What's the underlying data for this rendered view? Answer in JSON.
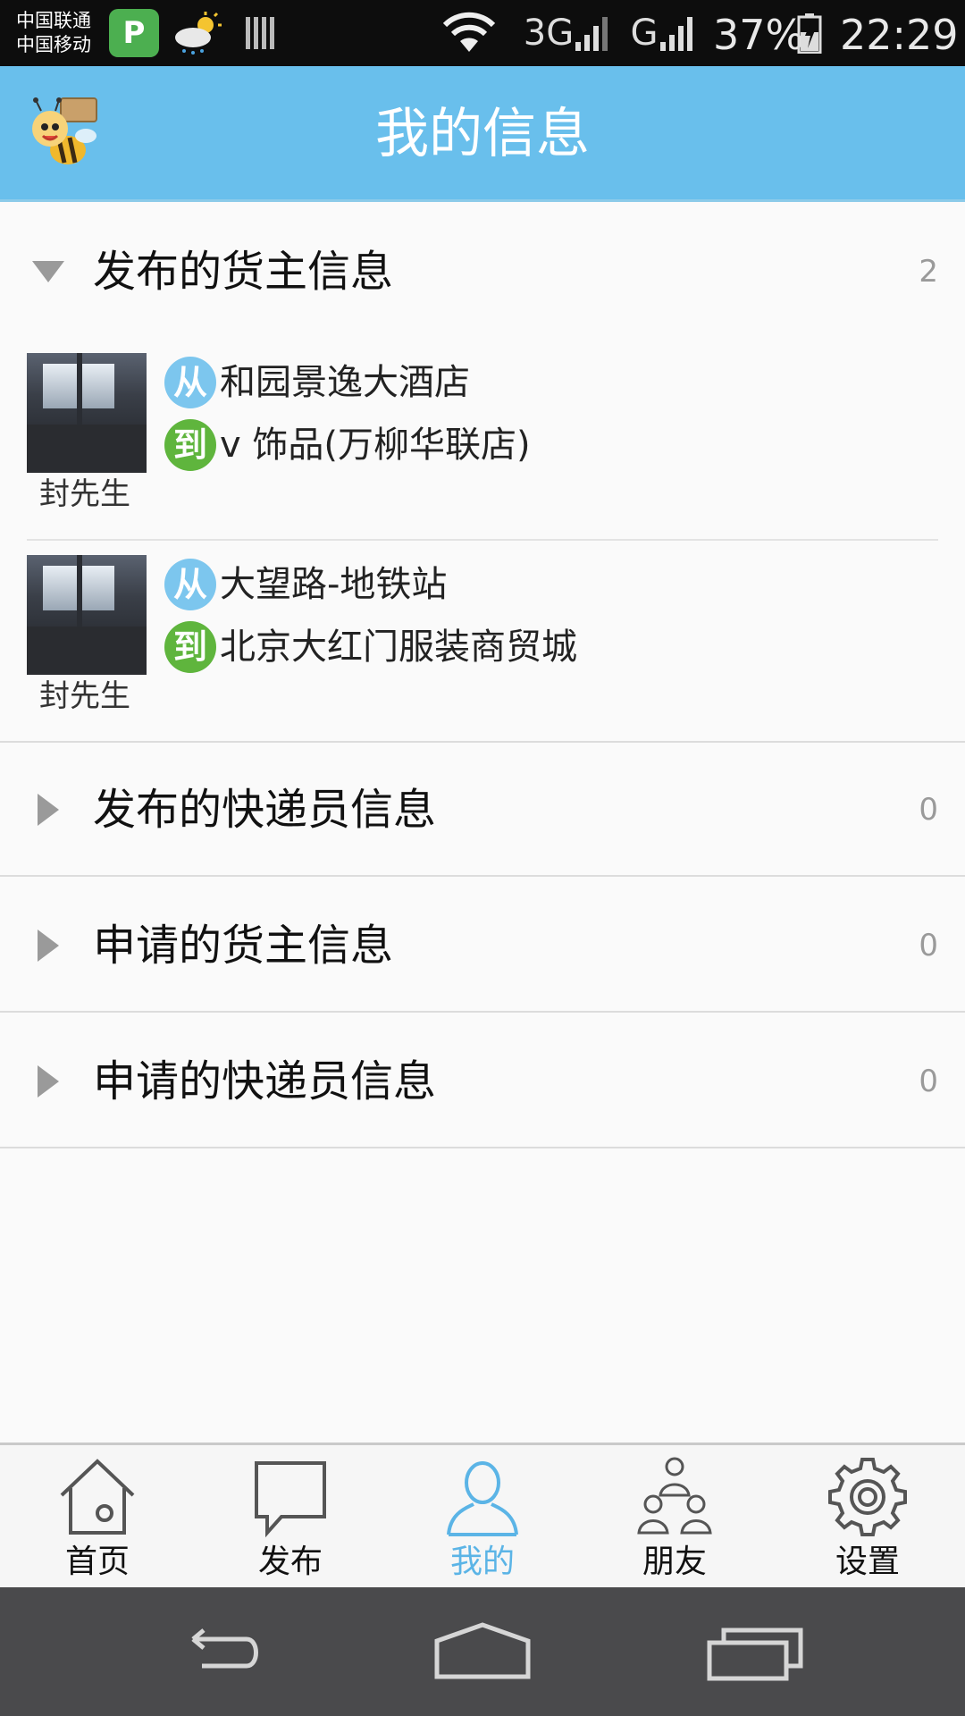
{
  "status_bar": {
    "carrier_1": "中国联通",
    "carrier_2": "中国移动",
    "app_icon_letter": "P",
    "signal_1_label": "3G",
    "signal_2_label": "G",
    "battery": "37%",
    "time": "22:29"
  },
  "header": {
    "title": "我的信息",
    "logo_icon": "bee-courier-mascot-icon"
  },
  "groups": [
    {
      "title": "发布的货主信息",
      "count": "2",
      "expanded": true,
      "items": [
        {
          "from_badge": "从",
          "from": "和园景逸大酒店",
          "to_badge": "到",
          "to": "v 饰品(万柳华联店)",
          "name": "封先生"
        },
        {
          "from_badge": "从",
          "from": "大望路-地铁站",
          "to_badge": "到",
          "to": "北京大红门服装商贸城",
          "name": "封先生"
        }
      ]
    },
    {
      "title": "发布的快递员信息",
      "count": "0",
      "expanded": false
    },
    {
      "title": "申请的货主信息",
      "count": "0",
      "expanded": false
    },
    {
      "title": "申请的快递员信息",
      "count": "0",
      "expanded": false
    }
  ],
  "bottom_nav": {
    "items": [
      {
        "label": "首页",
        "icon": "home-icon"
      },
      {
        "label": "发布",
        "icon": "speech-bubble-icon"
      },
      {
        "label": "我的",
        "icon": "user-icon",
        "active": true
      },
      {
        "label": "朋友",
        "icon": "friends-icon"
      },
      {
        "label": "设置",
        "icon": "gear-icon"
      }
    ]
  },
  "colors": {
    "header_bg": "#69bfec",
    "active_tab": "#5bb4e6",
    "from_badge": "#7cc6ee",
    "to_badge": "#5fb53d"
  }
}
